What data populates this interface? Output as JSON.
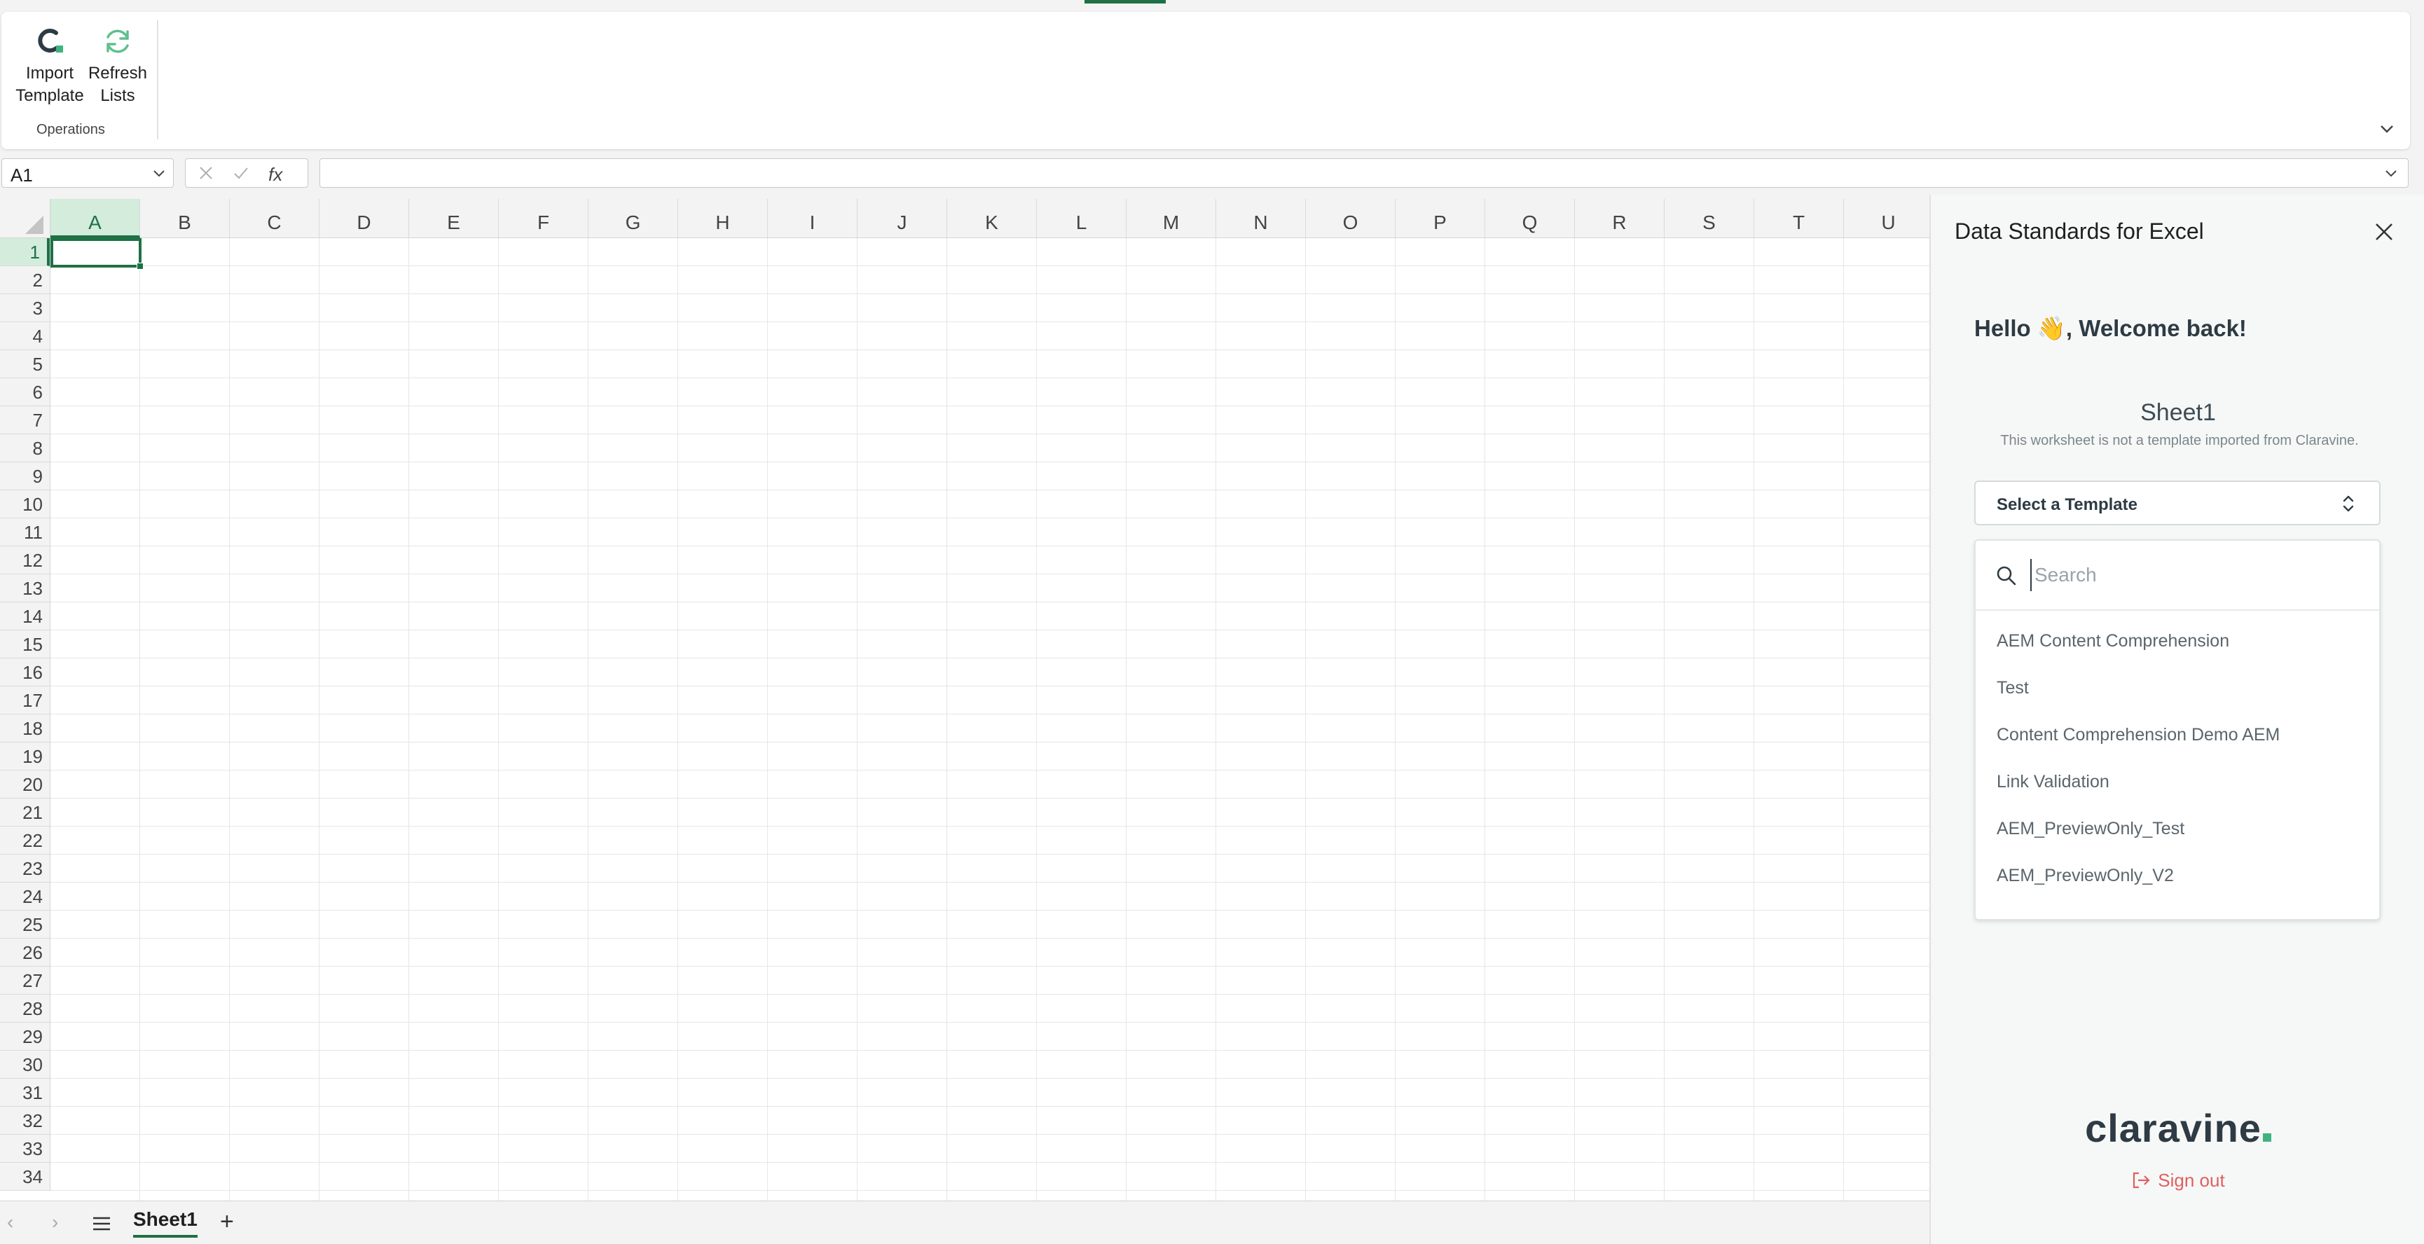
{
  "ribbon": {
    "buttons": [
      {
        "label_line1": "Import",
        "label_line2": "Template",
        "icon": "import-template-icon"
      },
      {
        "label_line1": "Refresh",
        "label_line2": "Lists",
        "icon": "refresh-icon"
      }
    ],
    "group_label": "Operations"
  },
  "formula_bar": {
    "name_box": "A1",
    "fx_label": "fx",
    "formula": ""
  },
  "grid": {
    "columns": [
      "A",
      "B",
      "C",
      "D",
      "E",
      "F",
      "G",
      "H",
      "I",
      "J",
      "K",
      "L",
      "M",
      "N",
      "O",
      "P",
      "Q",
      "R",
      "S",
      "T",
      "U"
    ],
    "rows": [
      "1",
      "2",
      "3",
      "4",
      "5",
      "6",
      "7",
      "8",
      "9",
      "10",
      "11",
      "12",
      "13",
      "14",
      "15",
      "16",
      "17",
      "18",
      "19",
      "20",
      "21",
      "22",
      "23",
      "24",
      "25",
      "26",
      "27",
      "28",
      "29",
      "30",
      "31",
      "32",
      "33",
      "34"
    ],
    "active_cell": "A1"
  },
  "sheets": {
    "tabs": [
      "Sheet1"
    ],
    "active": "Sheet1",
    "add_label": "+"
  },
  "task_pane": {
    "title": "Data Standards for Excel",
    "greeting": "Hello 👋, Welcome back!",
    "sheet_name": "Sheet1",
    "sheet_note": "This worksheet is not a template imported from Claravine.",
    "select_label": "Select a Template",
    "search_placeholder": "Search",
    "options": [
      "AEM Content Comprehension",
      "Test",
      "Content Comprehension Demo AEM",
      "Link Validation",
      "AEM_PreviewOnly_Test",
      "AEM_PreviewOnly_V2"
    ],
    "logo_text": "claravine",
    "sign_out": "Sign out"
  },
  "colors": {
    "excel_green": "#1e7145",
    "claravine_green": "#3fb37f",
    "signout_red": "#e06060"
  }
}
